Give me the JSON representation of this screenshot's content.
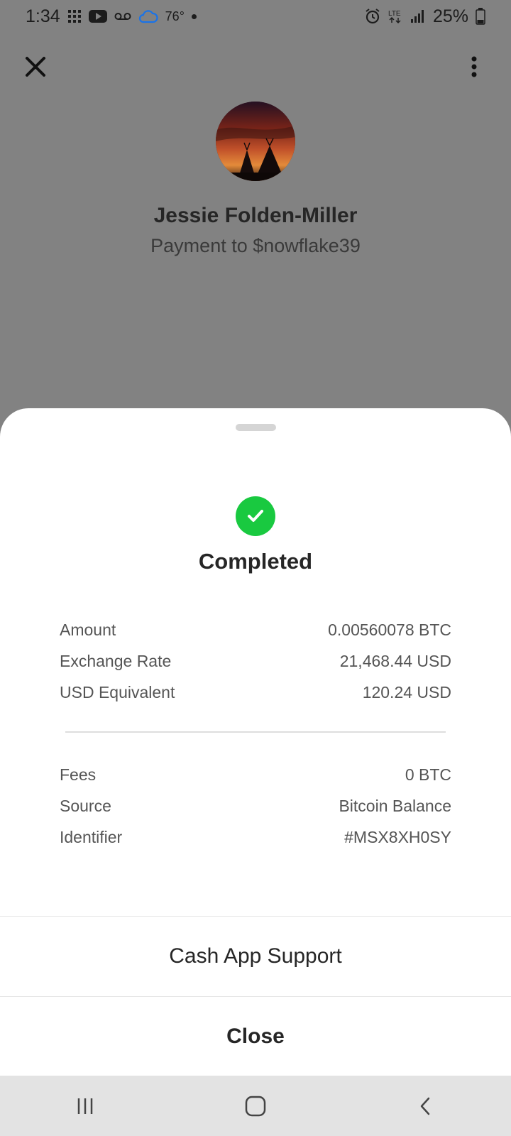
{
  "status_bar": {
    "time": "1:34",
    "temperature": "76°",
    "battery": "25%",
    "network": "LTE"
  },
  "payee": {
    "name": "Jessie Folden-Miller",
    "subtitle": "Payment to $nowflake39"
  },
  "sheet": {
    "status": "Completed",
    "details": [
      {
        "label": "Amount",
        "value": "0.00560078 BTC"
      },
      {
        "label": "Exchange Rate",
        "value": "21,468.44 USD"
      },
      {
        "label": "USD Equivalent",
        "value": "120.24 USD"
      }
    ],
    "details_2": [
      {
        "label": "Fees",
        "value": "0 BTC"
      },
      {
        "label": "Source",
        "value": "Bitcoin Balance"
      },
      {
        "label": "Identifier",
        "value": "#MSX8XH0SY"
      }
    ],
    "support_label": "Cash App Support",
    "close_label": "Close"
  },
  "colors": {
    "success": "#19c940",
    "overlay": "#828282",
    "nav_bar": "#e3e3e3"
  },
  "icons": {
    "close": "close-icon",
    "more": "more-vert-icon",
    "check": "check-icon",
    "nav_recents": "recents-icon",
    "nav_home": "home-icon",
    "nav_back": "back-icon"
  }
}
